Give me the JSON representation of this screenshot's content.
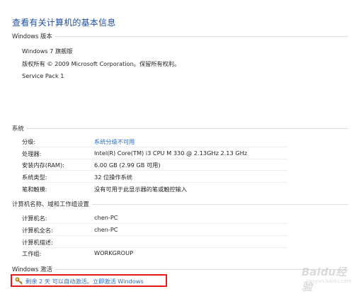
{
  "page": {
    "title": "查看有关计算机的基本信息"
  },
  "windows_edition": {
    "heading": "Windows 版本",
    "name": "Windows 7 旗舰版",
    "copyright": "版权所有 © 2009 Microsoft Corporation。保留所有权利。",
    "service_pack": "Service Pack 1"
  },
  "system": {
    "heading": "系统",
    "rows": [
      {
        "label": "分级:",
        "value": "系统分级不可用",
        "link": true
      },
      {
        "label": "处理器:",
        "value": "Intel(R) Core(TM) i3 CPU       M 330  @ 2.13GHz   2.13 GHz",
        "link": false
      },
      {
        "label": "安装内存(RAM):",
        "value": "6.00 GB (2.99 GB 可用)",
        "link": false
      },
      {
        "label": "系统类型:",
        "value": "32 位操作系统",
        "link": false
      },
      {
        "label": "笔和触摸:",
        "value": "没有可用于此显示器的笔或触控输入",
        "link": false
      }
    ]
  },
  "computer": {
    "heading": "计算机名称、域和工作组设置",
    "rows": [
      {
        "label": "计算机名:",
        "value": "chen-PC"
      },
      {
        "label": "计算机全名:",
        "value": "chen-PC"
      },
      {
        "label": "计算机描述:",
        "value": ""
      },
      {
        "label": "工作组:",
        "value": "WORKGROUP"
      }
    ]
  },
  "activation": {
    "heading": "Windows 激活",
    "link_text": "剩余 2 天 可以自动激活。立即激活 Windows",
    "icon": "key-icon",
    "highlight_color": "#e51a1a"
  },
  "watermark": {
    "main": "Baidu经验",
    "sub": "jingyan.baidu.com"
  }
}
